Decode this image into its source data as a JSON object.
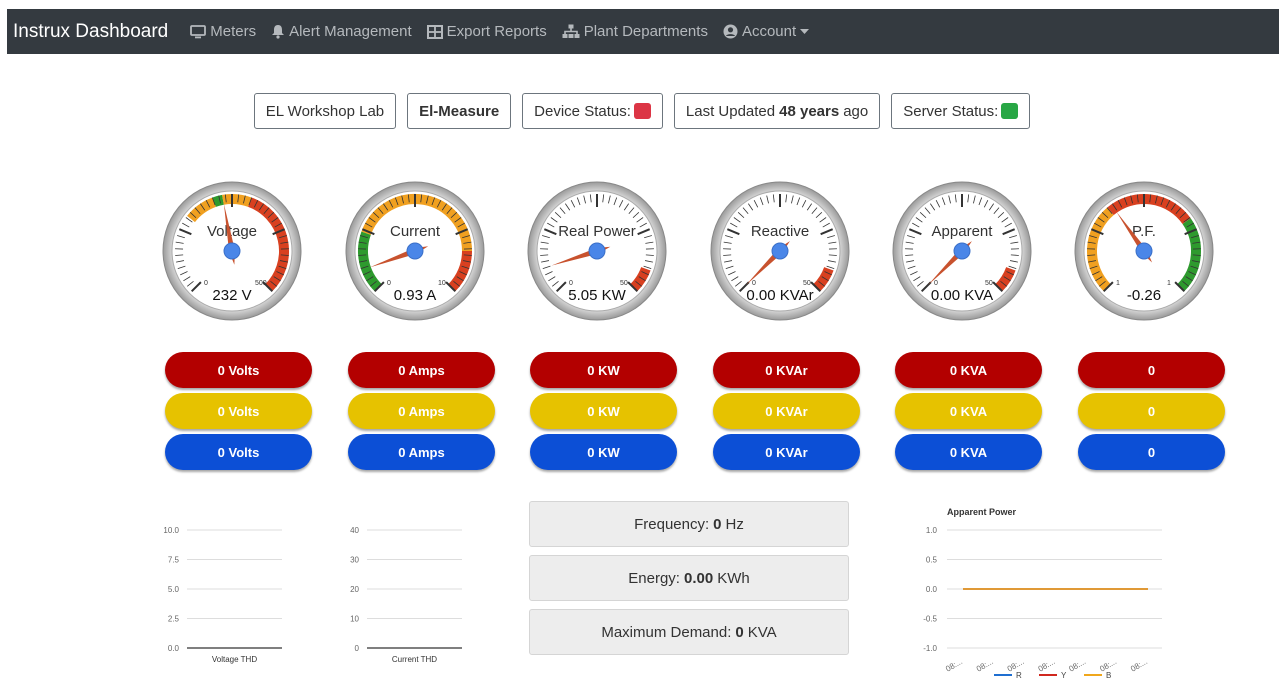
{
  "navbar": {
    "brand": "Instrux Dashboard",
    "items": [
      {
        "label": "Meters",
        "icon": "desktop-icon"
      },
      {
        "label": "Alert Management",
        "icon": "bell-icon"
      },
      {
        "label": "Export Reports",
        "icon": "table-icon"
      },
      {
        "label": "Plant Departments",
        "icon": "sitemap-icon"
      },
      {
        "label": "Account",
        "icon": "user-circle-icon"
      }
    ]
  },
  "status": {
    "lab": "EL Workshop Lab",
    "device_name": "El-Measure",
    "device_status_label": "Device Status:",
    "device_status_color": "#dc3545",
    "last_updated_prefix": "Last Updated",
    "last_updated_value": "48 years",
    "last_updated_suffix": "ago",
    "server_status_label": "Server Status:",
    "server_status_color": "#28a745"
  },
  "gauges": [
    {
      "title": "Voltage",
      "value_text": "232 V",
      "min": "0",
      "max": "500",
      "fraction": 0.464
    },
    {
      "title": "Current",
      "value_text": "0.93 A",
      "min": "0",
      "max": "10",
      "fraction": 0.093
    },
    {
      "title": "Real Power",
      "value_text": "5.05 KW",
      "min": "0",
      "max": "50",
      "fraction": 0.101
    },
    {
      "title": "Reactive",
      "value_text": "0.00 KVAr",
      "min": "0",
      "max": "50",
      "fraction": 0.0
    },
    {
      "title": "Apparent",
      "value_text": "0.00 KVA",
      "min": "0",
      "max": "50",
      "fraction": 0.0
    },
    {
      "title": "P.F.",
      "value_text": "-0.26",
      "min": "1",
      "max": "1",
      "fraction": 0.37
    }
  ],
  "phases": [
    {
      "red": "0 Volts",
      "yellow": "0 Volts",
      "blue": "0 Volts"
    },
    {
      "red": "0 Amps",
      "yellow": "0 Amps",
      "blue": "0 Amps"
    },
    {
      "red": "0 KW",
      "yellow": "0 KW",
      "blue": "0 KW"
    },
    {
      "red": "0 KVAr",
      "yellow": "0 KVAr",
      "blue": "0 KVAr"
    },
    {
      "red": "0 KVA",
      "yellow": "0 KVA",
      "blue": "0 KVA"
    },
    {
      "red": "0",
      "yellow": "0",
      "blue": "0"
    }
  ],
  "info": {
    "frequency_label": "Frequency:",
    "frequency_value": "0",
    "frequency_unit": "Hz",
    "energy_label": "Energy:",
    "energy_value": "0.00",
    "energy_unit": "KWh",
    "demand_label": "Maximum Demand:",
    "demand_value": "0",
    "demand_unit": "KVA"
  },
  "chart_data": [
    {
      "type": "line",
      "xlabel": "Voltage THD",
      "y_ticks": [
        "10.0",
        "7.5",
        "5.0",
        "2.5",
        "0.0"
      ],
      "ylim": [
        0,
        10
      ],
      "series": []
    },
    {
      "type": "line",
      "xlabel": "Current THD",
      "y_ticks": [
        "40",
        "30",
        "20",
        "10",
        "0"
      ],
      "ylim": [
        0,
        40
      ],
      "series": []
    },
    {
      "type": "line",
      "title": "Apparent Power",
      "y_ticks": [
        "1.0",
        "0.5",
        "0.0",
        "-0.5",
        "-1.0"
      ],
      "ylim": [
        -1,
        1
      ],
      "x_ticks": [
        "08:...",
        "08:...",
        "08:...",
        "08:...",
        "08:...",
        "08:...",
        "08:..."
      ],
      "legend_position": "bottom",
      "series": [
        {
          "name": "R",
          "color": "#1f6fd1",
          "values": [
            0,
            0,
            0,
            0,
            0,
            0,
            0
          ]
        },
        {
          "name": "Y",
          "color": "#d0281f",
          "values": [
            0,
            0,
            0,
            0,
            0,
            0,
            0
          ]
        },
        {
          "name": "B",
          "color": "#f0a71c",
          "values": [
            0,
            0,
            0,
            0,
            0,
            0,
            0
          ]
        }
      ]
    }
  ]
}
